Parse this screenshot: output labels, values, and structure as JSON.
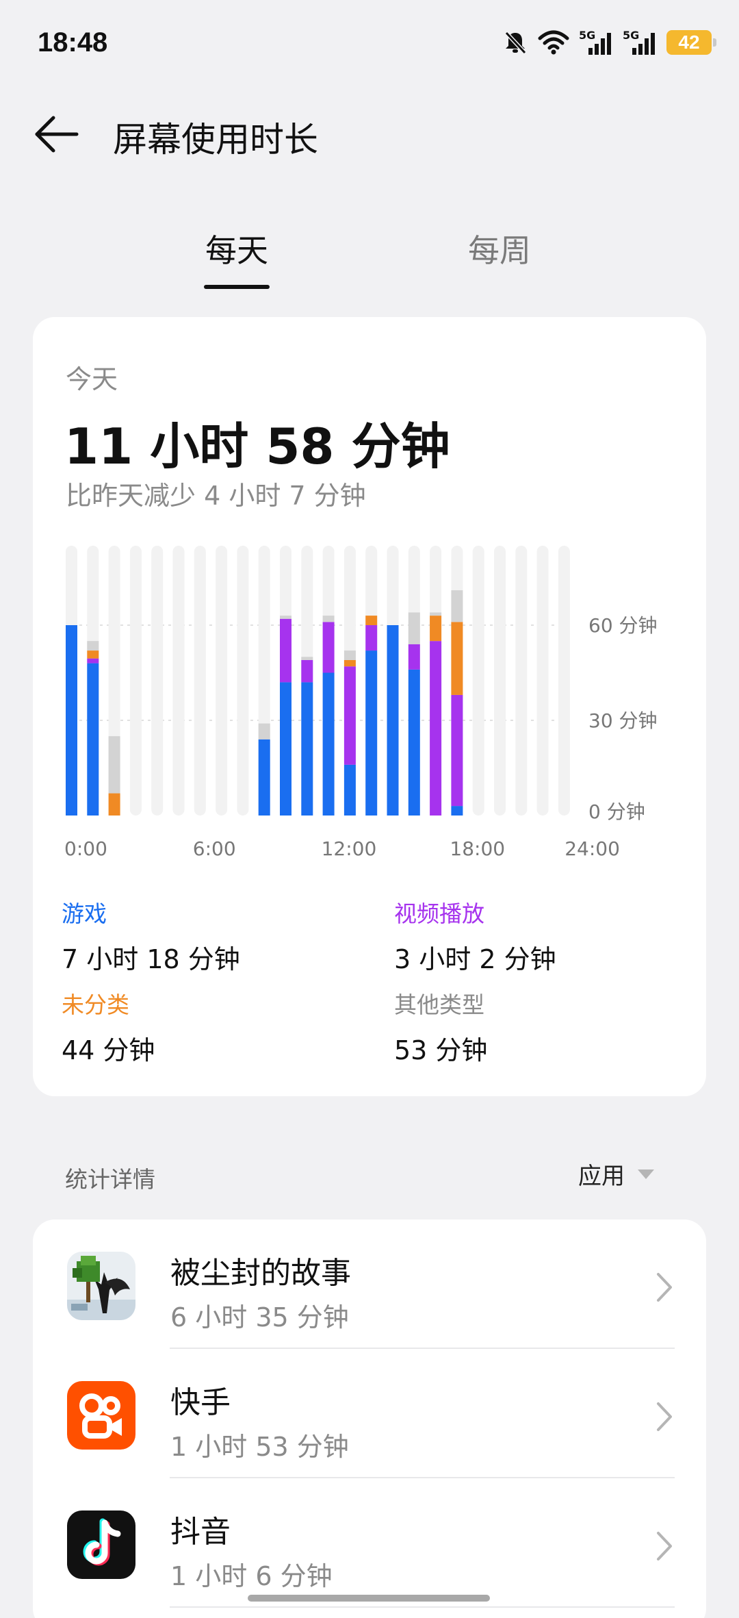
{
  "status_bar": {
    "time": "18:48",
    "icons": [
      "mute-bell-icon",
      "wifi-icon",
      "signal-5g-icon",
      "signal-5g-icon",
      "battery-icon"
    ],
    "signal_labels": [
      "5G",
      "5G"
    ],
    "battery_level": "42",
    "battery_color": "#f5b82e"
  },
  "header": {
    "back_icon": "arrow-left-icon",
    "title": "屏幕使用时长"
  },
  "tabs": [
    {
      "label": "每天",
      "selected": true
    },
    {
      "label": "每周",
      "selected": false
    }
  ],
  "summary": {
    "today_label": "今天",
    "total_time": "11 小时 58 分钟",
    "compare_text": "比昨天减少 4 小时 7 分钟"
  },
  "chart_data": {
    "type": "bar",
    "stacked": true,
    "x": [
      "0:00",
      "1:00",
      "2:00",
      "3:00",
      "4:00",
      "5:00",
      "6:00",
      "7:00",
      "8:00",
      "9:00",
      "10:00",
      "11:00",
      "12:00",
      "13:00",
      "14:00",
      "15:00",
      "16:00",
      "17:00",
      "18:00",
      "19:00",
      "20:00",
      "21:00",
      "22:00",
      "23:00"
    ],
    "x_tick_labels": [
      "0:00",
      "6:00",
      "12:00",
      "18:00",
      "24:00"
    ],
    "y_tick_labels": [
      "60 分钟",
      "30 分钟",
      "0 分钟"
    ],
    "y_ticks": [
      60,
      30,
      0
    ],
    "ylim": [
      0,
      85
    ],
    "y_position": "right",
    "grid": "dashed at 30 and 60",
    "series": [
      {
        "name": "游戏",
        "color": "#1a6ef0",
        "values": [
          60,
          48,
          0,
          0,
          0,
          0,
          0,
          0,
          0,
          24,
          42,
          42,
          45,
          16,
          52,
          60,
          46,
          0,
          3,
          0,
          0,
          0,
          0,
          0
        ]
      },
      {
        "name": "视频播放",
        "color": "#a633ee",
        "values": [
          0,
          1.5,
          0,
          0,
          0,
          0,
          0,
          0,
          0,
          0,
          20,
          7,
          16,
          31,
          8,
          0,
          8,
          55,
          35,
          0,
          0,
          0,
          0,
          0
        ]
      },
      {
        "name": "未分类",
        "color": "#f08a24",
        "values": [
          0,
          2.5,
          7,
          0,
          0,
          0,
          0,
          0,
          0,
          0,
          0,
          0,
          0,
          2,
          3,
          0,
          0,
          8,
          23,
          0,
          0,
          0,
          0,
          0
        ]
      },
      {
        "name": "其他类型",
        "color": "#d3d3d3",
        "values": [
          0,
          3,
          18,
          0,
          0,
          0,
          0,
          0,
          0,
          5,
          1,
          1,
          2,
          3,
          0,
          0,
          10,
          1,
          10,
          0,
          0,
          0,
          0,
          0
        ]
      }
    ]
  },
  "legend": [
    {
      "name": "游戏",
      "value": "7 小时 18 分钟",
      "color": "#1a6ef0"
    },
    {
      "name": "视频播放",
      "value": "3 小时 2 分钟",
      "color": "#a633ee"
    },
    {
      "name": "未分类",
      "value": "44 分钟",
      "color": "#f08a24"
    },
    {
      "name": "其他类型",
      "value": "53 分钟",
      "color": "#8a8a8a"
    }
  ],
  "details": {
    "title": "统计详情",
    "filter_label": "应用",
    "filter_icon": "caret-down-icon"
  },
  "apps": [
    {
      "name": "被尘封的故事",
      "time": "6 小时 35 分钟",
      "icon": "game-tree-icon"
    },
    {
      "name": "快手",
      "time": "1 小时 53 分钟",
      "icon": "kuaishou-icon"
    },
    {
      "name": "抖音",
      "time": "1 小时 6 分钟",
      "icon": "douyin-icon"
    }
  ]
}
